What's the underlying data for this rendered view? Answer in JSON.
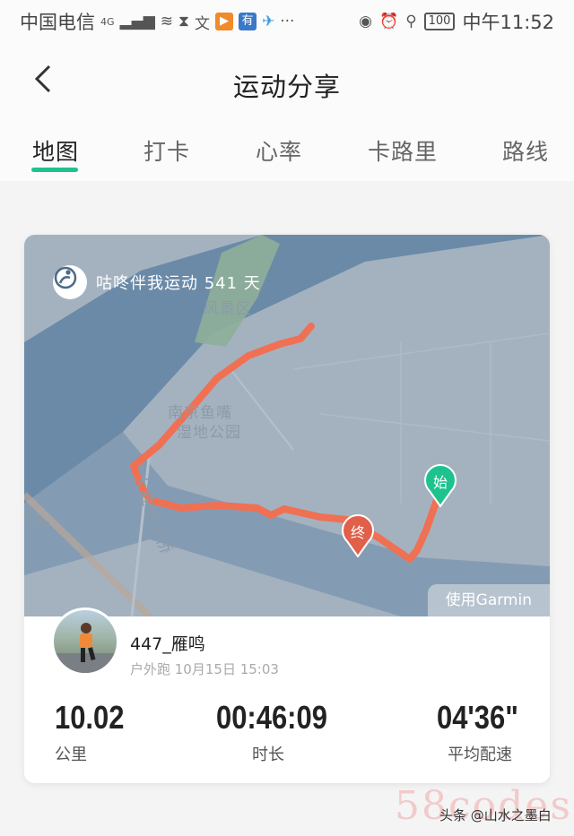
{
  "status_bar": {
    "carrier": "中国电信",
    "network": "4G",
    "battery": "100",
    "time": "中午11:52"
  },
  "header": {
    "title": "运动分享"
  },
  "tabs": [
    {
      "label": "地图",
      "active": true
    },
    {
      "label": "打卡",
      "active": false
    },
    {
      "label": "心率",
      "active": false
    },
    {
      "label": "卡路里",
      "active": false
    },
    {
      "label": "路线",
      "active": false
    }
  ],
  "map": {
    "brand_text": "咕咚伴我运动 541 天",
    "labels": [
      "风景区",
      "南京鱼嘴",
      "湿地公园",
      "大胜关大桥",
      "大桥"
    ],
    "start_pin": "始",
    "end_pin": "终",
    "device_tag": "使用Garmin"
  },
  "user": {
    "name": "447_雁鸣",
    "activity_meta": "户外跑 10月15日 15:03"
  },
  "stats": {
    "distance_value": "10.02",
    "distance_label": "公里",
    "duration_value": "00:46:09",
    "duration_label": "时长",
    "pace_value": "04'36\"",
    "pace_label": "平均配速"
  },
  "watermark": {
    "site": "58codes",
    "source": "头条 @山水之墨白"
  },
  "colors": {
    "accent": "#1ec28e",
    "route": "#f07054",
    "map_land": "#a4b2c0",
    "map_water": "#6a8aa8"
  }
}
